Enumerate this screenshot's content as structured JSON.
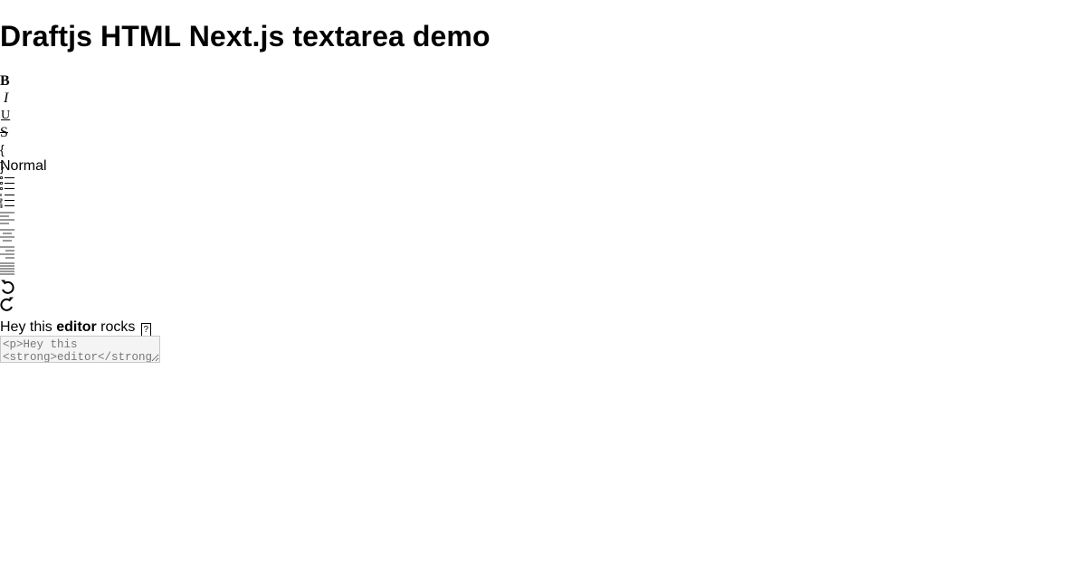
{
  "page": {
    "title": "Draftjs HTML Next.js textarea demo"
  },
  "toolbar": {
    "bold_label": "B",
    "italic_label": "I",
    "underline_label": "U",
    "strikethrough_label": "S",
    "code_label": "{ }",
    "block_type_value": "Normal"
  },
  "editor": {
    "text_before": "Hey this ",
    "text_bold": "editor",
    "text_after": " rocks",
    "unknown_glyph": "?"
  },
  "html_output": {
    "value": "<p>Hey this <strong>editor</strong> rocks</p>"
  }
}
